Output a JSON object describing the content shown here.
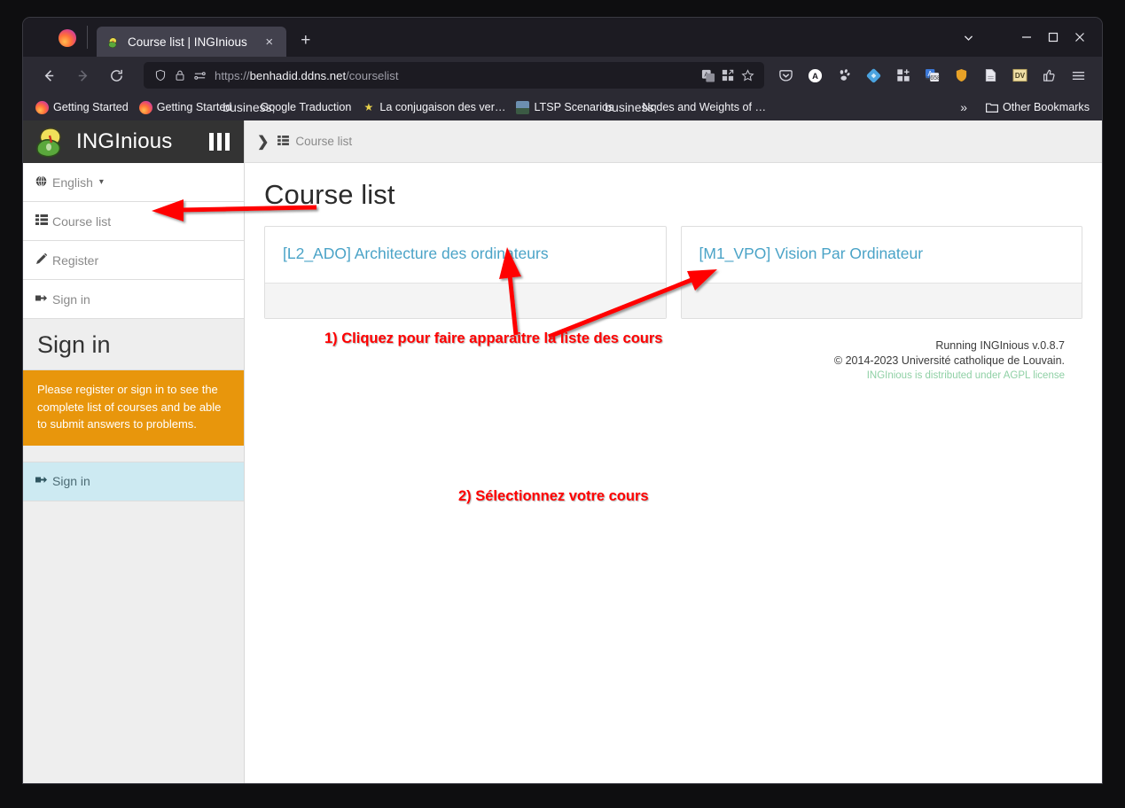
{
  "browser": {
    "tab": {
      "title": "Course list | INGInious",
      "favicon": "inginious-icon",
      "close": "×"
    },
    "newtab_label": "+",
    "window_controls": {
      "list": "list-all-tabs-icon",
      "minimize": "—",
      "maximize": "□",
      "close": "✕"
    },
    "nav": {
      "back": "←",
      "forward": "→",
      "reload": "⟳"
    },
    "url": {
      "protocol": "https://",
      "host": "benhadid.ddns.net",
      "path": "/courselist",
      "full": "https://benhadid.ddns.net/courselist"
    },
    "url_icons": [
      "shield-icon",
      "lock-icon",
      "permissions-icon"
    ],
    "url_right_icons": [
      "translate-icon",
      "reader-grid-icon",
      "bookmark-star-icon"
    ],
    "toolbar_icons": [
      "pocket-icon",
      "account-icon",
      "gnome-icon",
      "gitlab-icon",
      "extensions-icon",
      "translate-ext-icon",
      "ublock-shield-icon",
      "page-icon",
      "dv-icon",
      "thumbs-up-icon",
      "app-menu-icon"
    ],
    "bookmarks": [
      {
        "label": "Getting Started",
        "icon": "firefox-icon"
      },
      {
        "label": "Getting Started",
        "icon": "firefox-icon"
      },
      {
        "label": "Google Traduction",
        "icon": "globe-icon"
      },
      {
        "label": "La conjugaison des ver…",
        "icon": "conjugaison-icon"
      },
      {
        "label": "LTSP Scenarios",
        "icon": "person-photo-icon"
      },
      {
        "label": "Nodes and Weights of …",
        "icon": "globe-icon"
      }
    ],
    "bookmarks_overflow": "»",
    "other_bookmarks": {
      "label": "Other Bookmarks",
      "icon": "folder-icon"
    }
  },
  "sidebar": {
    "brand": "INGInious",
    "logo": "inginious-mascot-logo",
    "toggle": "sidebar-toggle-icon",
    "items": [
      {
        "label": "English",
        "icon": "globe-icon",
        "caret": "▾",
        "active": false
      },
      {
        "label": "Course list",
        "icon": "list-icon",
        "active": false
      },
      {
        "label": "Register",
        "icon": "pencil-icon",
        "active": false
      },
      {
        "label": "Sign in",
        "icon": "sign-in-icon",
        "active": false
      }
    ],
    "signin_title": "Sign in",
    "alert": "Please register or sign in to see the complete list of courses and be able to submit answers to problems.",
    "signin_item": {
      "label": "Sign in",
      "icon": "sign-in-icon",
      "active": true
    },
    "alert_color": "#e8960c",
    "active_color": "#cdeaf2"
  },
  "main": {
    "breadcrumb": {
      "chevron": "❯",
      "icon": "list-icon",
      "label": "Course list"
    },
    "page_title": "Course list",
    "courses": [
      {
        "label": "[L2_ADO] Architecture des ordinateurs"
      },
      {
        "label": "[M1_VPO] Vision Par Ordinateur"
      }
    ],
    "link_color": "#4aa3c7",
    "footer": {
      "version": "Running INGInious v.0.8.7",
      "copyright": "© 2014-2023 Université catholique de Louvain.",
      "license": "INGInious is distributed under AGPL license",
      "license_color": "#8fd0a5"
    }
  },
  "annotations": {
    "color": "#ff0000",
    "step1": "1) Cliquez pour faire apparaitre la liste des cours",
    "step2": "2) Sélectionnez votre cours"
  }
}
